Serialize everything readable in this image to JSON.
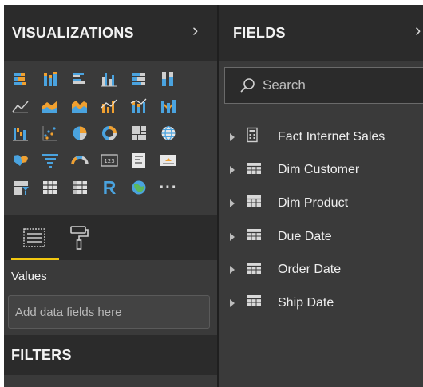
{
  "visualizations": {
    "title": "VISUALIZATIONS",
    "expand_glyph": "›",
    "icons": [
      "stacked-bar-icon",
      "stacked-column-icon",
      "clustered-bar-icon",
      "clustered-column-icon",
      "100-stacked-bar-icon",
      "100-stacked-column-icon",
      "blank",
      "line-chart-icon",
      "area-chart-icon",
      "stacked-area-icon",
      "line-clustered-column-icon",
      "line-stacked-column-icon",
      "ribbon-chart-icon",
      "blank",
      "waterfall-icon",
      "scatter-icon",
      "pie-icon",
      "donut-icon",
      "treemap-icon",
      "map-icon",
      "blank",
      "filled-map-icon",
      "funnel-icon",
      "gauge-icon",
      "card-icon",
      "multi-row-card-icon",
      "kpi-icon",
      "blank",
      "slicer-icon",
      "table-icon",
      "matrix-icon",
      "r-visual-icon",
      "arcgis-icon",
      "more-icon",
      "blank"
    ],
    "r_label": "R",
    "more_label": "···",
    "tabs": [
      {
        "name": "fields-tab",
        "icon": "fields-well-icon"
      },
      {
        "name": "format-tab",
        "icon": "paint-roller-icon"
      }
    ],
    "values_label": "Values",
    "drop_placeholder": "Add data fields here"
  },
  "filters": {
    "title": "FILTERS"
  },
  "fields": {
    "title": "FIELDS",
    "expand_glyph": "›",
    "search_placeholder": "Search",
    "tables": [
      {
        "label": "Fact Internet Sales",
        "icon": "calculator-table-icon"
      },
      {
        "label": "Dim Customer",
        "icon": "table-icon"
      },
      {
        "label": "Dim Product",
        "icon": "table-icon"
      },
      {
        "label": "Due Date",
        "icon": "table-icon"
      },
      {
        "label": "Order Date",
        "icon": "table-icon"
      },
      {
        "label": "Ship Date",
        "icon": "table-icon"
      }
    ]
  },
  "colors": {
    "accent": "#f2c811",
    "icon_blue": "#4aa3df",
    "icon_orange": "#f0a030",
    "icon_gray": "#9a9a9a"
  }
}
